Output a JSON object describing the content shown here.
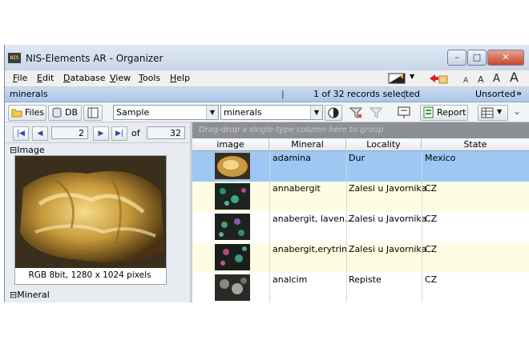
{
  "window": {
    "title": "NIS-Elements AR - Organizer",
    "app_icon_text": "NIS"
  },
  "menu": [
    "File",
    "Edit",
    "Database",
    "View",
    "Tools",
    "Help"
  ],
  "zoom_letters": [
    "A",
    "A",
    "A",
    "A"
  ],
  "breadbar": {
    "path": "minerals",
    "selection": "1 of 32 records selected",
    "sort": "Unsorted",
    "more": "»"
  },
  "toolbar": {
    "files_label": "Files",
    "db_label": "DB",
    "sample_value": "Sample",
    "minerals_value": "minerals",
    "report_label": "Report"
  },
  "navigator": {
    "current": "2",
    "of_label": "of",
    "total": "32"
  },
  "left_panel": {
    "image_section": "Image",
    "image_caption": "RGB 8bit, 1280 x 1024 pixels",
    "mineral_section": "Mineral"
  },
  "grid": {
    "group_hint": "Drag-drop a single-type column here to group",
    "columns": [
      "image",
      "Mineral",
      "Locality",
      "State"
    ],
    "rows": [
      {
        "mineral": "adamina",
        "locality": "Dur",
        "state": "Mexico"
      },
      {
        "mineral": "annabergit",
        "locality": "Zalesi u Javornika",
        "state": "CZ"
      },
      {
        "mineral": "anabergit, laven...",
        "locality": "Zalesi u Javornika",
        "state": "CZ"
      },
      {
        "mineral": "anabergit,erytrin",
        "locality": "Zalesi u Javornika",
        "state": "CZ"
      },
      {
        "mineral": "analcim",
        "locality": "Repiste",
        "state": "CZ"
      }
    ]
  },
  "colors": {
    "selected_row": "#9ec7f3",
    "alt_row": "#fefde3",
    "header_bar": "#aac6e8"
  }
}
